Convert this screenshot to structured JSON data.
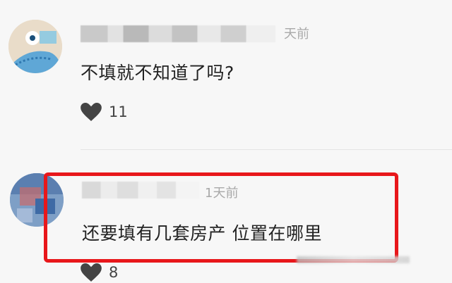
{
  "comments": [
    {
      "time": "天前",
      "text": "不填就不知道了吗?",
      "likes": "11",
      "icons": {
        "avatar": "avatar",
        "like": "heart-icon"
      }
    },
    {
      "time": "1天前",
      "text": "还要填有几套房产 位置在哪里",
      "likes": "8",
      "icons": {
        "avatar": "avatar",
        "like": "heart-icon"
      }
    }
  ],
  "colors": {
    "background": "#f7f7f7",
    "text": "#222222",
    "meta": "#a9a9a9",
    "highlight": "#e8171b"
  }
}
